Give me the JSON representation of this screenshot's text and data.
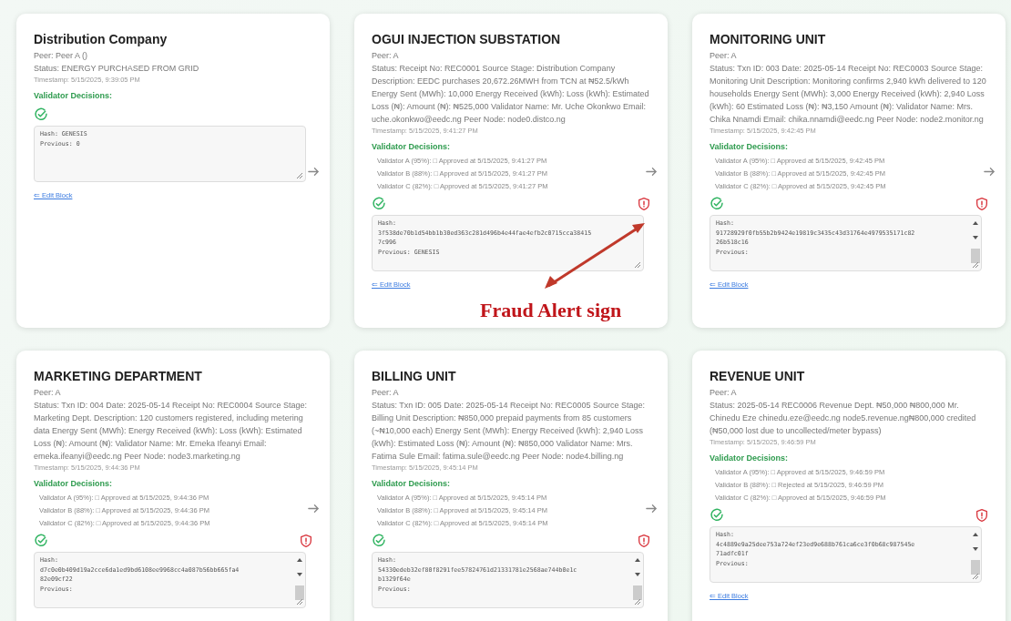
{
  "cards": [
    {
      "title": "Distribution Company",
      "arrow": true,
      "peer": "Peer: Peer A ()",
      "status": "Status: ENERGY PURCHASED FROM GRID",
      "timestamp": "Timestamp: 5/15/2025, 9:39:05 PM",
      "decisions_heading": "Validator Decisions:",
      "approved": true,
      "fraud_alert": false,
      "hash_lines": [
        "Hash: GENESIS",
        "Previous: 0"
      ],
      "scrollbar": false,
      "edit_link": "⇐ Edit Block"
    },
    {
      "title": "OGUI INJECTION SUBSTATION",
      "arrow": true,
      "peer": "Peer: A",
      "status": "Status: Receipt No: REC0001 Source Stage: Distribution Company Description: EEDC purchases 20,672.26MWH from TCN at ₦52.5/kWh Energy Sent (MWh): 10,000 Energy Received (kWh): Loss (kWh): Estimated Loss (₦): Amount (₦): ₦525,000 Validator Name: Mr. Uche Okonkwo Email: uche.okonkwo@eedc.ng Peer Node: node0.distco.ng",
      "timestamp": "Timestamp: 5/15/2025, 9:41:27 PM",
      "decisions_heading": "Validator Decisions:",
      "decisions": [
        "Validator A (95%): □ Approved at 5/15/2025, 9:41:27 PM",
        "Validator B (88%): □ Approved at 5/15/2025, 9:41:27 PM",
        "Validator C (82%): □ Approved at 5/15/2025, 9:41:27 PM"
      ],
      "approved": true,
      "fraud_alert": true,
      "hash_lines": [
        "Hash:",
        "3f538de70b1d54bb1b30ed363c281d496b4e44fae4efb2c0715cca38415",
        "7c996",
        "Previous: GENESIS"
      ],
      "scrollbar": false,
      "edit_link": "⇐ Edit Block"
    },
    {
      "title": "MONITORING UNIT",
      "arrow": true,
      "peer": "Peer: A",
      "status": "Status: Txn ID: 003 Date: 2025-05-14 Receipt No: REC0003 Source Stage: Monitoring Unit Description: Monitoring confirms 2,940 kWh delivered to 120 households Energy Sent (MWh): 3,000 Energy Received (kWh): 2,940 Loss (kWh): 60 Estimated Loss (₦): ₦3,150 Amount (₦): Validator Name: Mrs. Chika Nnamdi Email: chika.nnamdi@eedc.ng Peer Node: node2.monitor.ng",
      "timestamp": "Timestamp: 5/15/2025, 9:42:45 PM",
      "decisions_heading": "Validator Decisions:",
      "decisions": [
        "Validator A (95%): □ Approved at 5/15/2025, 9:42:45 PM",
        "Validator B (88%): □ Approved at 5/15/2025, 9:42:45 PM",
        "Validator C (82%): □ Approved at 5/15/2025, 9:42:45 PM"
      ],
      "approved": true,
      "fraud_alert": true,
      "hash_lines": [
        "Hash:",
        "91728929f0fb55b2b9424e19819c3435c43d31764e4979535171c82",
        "26b518c16",
        "Previous:"
      ],
      "scrollbar": true,
      "edit_link": "⇐ Edit Block"
    },
    {
      "title": "MARKETING DEPARTMENT",
      "arrow": true,
      "peer": "Peer: A",
      "status": "Status: Txn ID: 004 Date: 2025-05-14 Receipt No: REC0004 Source Stage: Marketing Dept. Description: 120 customers registered, including metering data Energy Sent (MWh): Energy Received (kWh): Loss (kWh): Estimated Loss (₦): Amount (₦): Validator Name: Mr. Emeka Ifeanyi Email: emeka.ifeanyi@eedc.ng Peer Node: node3.marketing.ng",
      "timestamp": "Timestamp: 5/15/2025, 9:44:36 PM",
      "decisions_heading": "Validator Decisions:",
      "decisions": [
        "Validator A (95%): □ Approved at 5/15/2025, 9:44:36 PM",
        "Validator B (88%): □ Approved at 5/15/2025, 9:44:36 PM",
        "Validator C (82%): □ Approved at 5/15/2025, 9:44:36 PM"
      ],
      "approved": true,
      "fraud_alert": true,
      "hash_lines": [
        "Hash:",
        "d7c0e0b409d19a2cce6da1ed9bd6108ee9968cc4a087b56bb665fa4",
        "82e09cf22",
        "Previous:"
      ],
      "scrollbar": true
    },
    {
      "title": "BILLING UNIT",
      "arrow": true,
      "peer": "Peer: A",
      "status": "Status: Txn ID: 005 Date: 2025-05-14 Receipt No: REC0005 Source Stage: Billing Unit Description: ₦850,000 prepaid payments from 85 customers (~₦10,000 each) Energy Sent (MWh): Energy Received (kWh): 2,940 Loss (kWh): Estimated Loss (₦): Amount (₦): ₦850,000 Validator Name: Mrs. Fatima Sule Email: fatima.sule@eedc.ng Peer Node: node4.billing.ng",
      "timestamp": "Timestamp: 5/15/2025, 9:45:14 PM",
      "decisions_heading": "Validator Decisions:",
      "decisions": [
        "Validator A (95%): □ Approved at 5/15/2025, 9:45:14 PM",
        "Validator B (88%): □ Approved at 5/15/2025, 9:45:14 PM",
        "Validator C (82%): □ Approved at 5/15/2025, 9:45:14 PM"
      ],
      "approved": true,
      "fraud_alert": true,
      "hash_lines": [
        "Hash:",
        "54330edeb32ef80f8291fee57824761d21331781e2568ae744b0e1c",
        "b1329f64e",
        "Previous:"
      ],
      "scrollbar": true
    },
    {
      "title": "REVENUE UNIT",
      "peer": "Peer: A",
      "status": "Status: 2025-05-14 REC0006 Revenue Dept. ₦50,000 ₦800,000 Mr. Chinedu Eze chinedu.eze@eedc.ng node5.revenue.ng₦800,000 credited (₦50,000 lost due to uncollected/meter bypass)",
      "timestamp": "Timestamp: 5/15/2025, 9:46:59 PM",
      "decisions_heading": "Validator Decisions:",
      "decisions": [
        "Validator A (95%): □ Approved at 5/15/2025, 9:46:59 PM",
        "Validator B (88%): □ Rejected at 5/15/2025, 9:46:59 PM",
        "Validator C (82%): □ Approved at 5/15/2025, 9:46:59 PM"
      ],
      "approved": true,
      "fraud_alert": true,
      "hash_lines": [
        "Hash:",
        "4c4889e9a25dee753a724ef23ed9e688b761ca6ce3f0b68c987545e",
        "71adfc01f",
        "Previous:"
      ],
      "scrollbar": true,
      "edit_link": "⇐ Edit Block"
    }
  ],
  "annotation": {
    "text": "Fraud Alert sign"
  }
}
